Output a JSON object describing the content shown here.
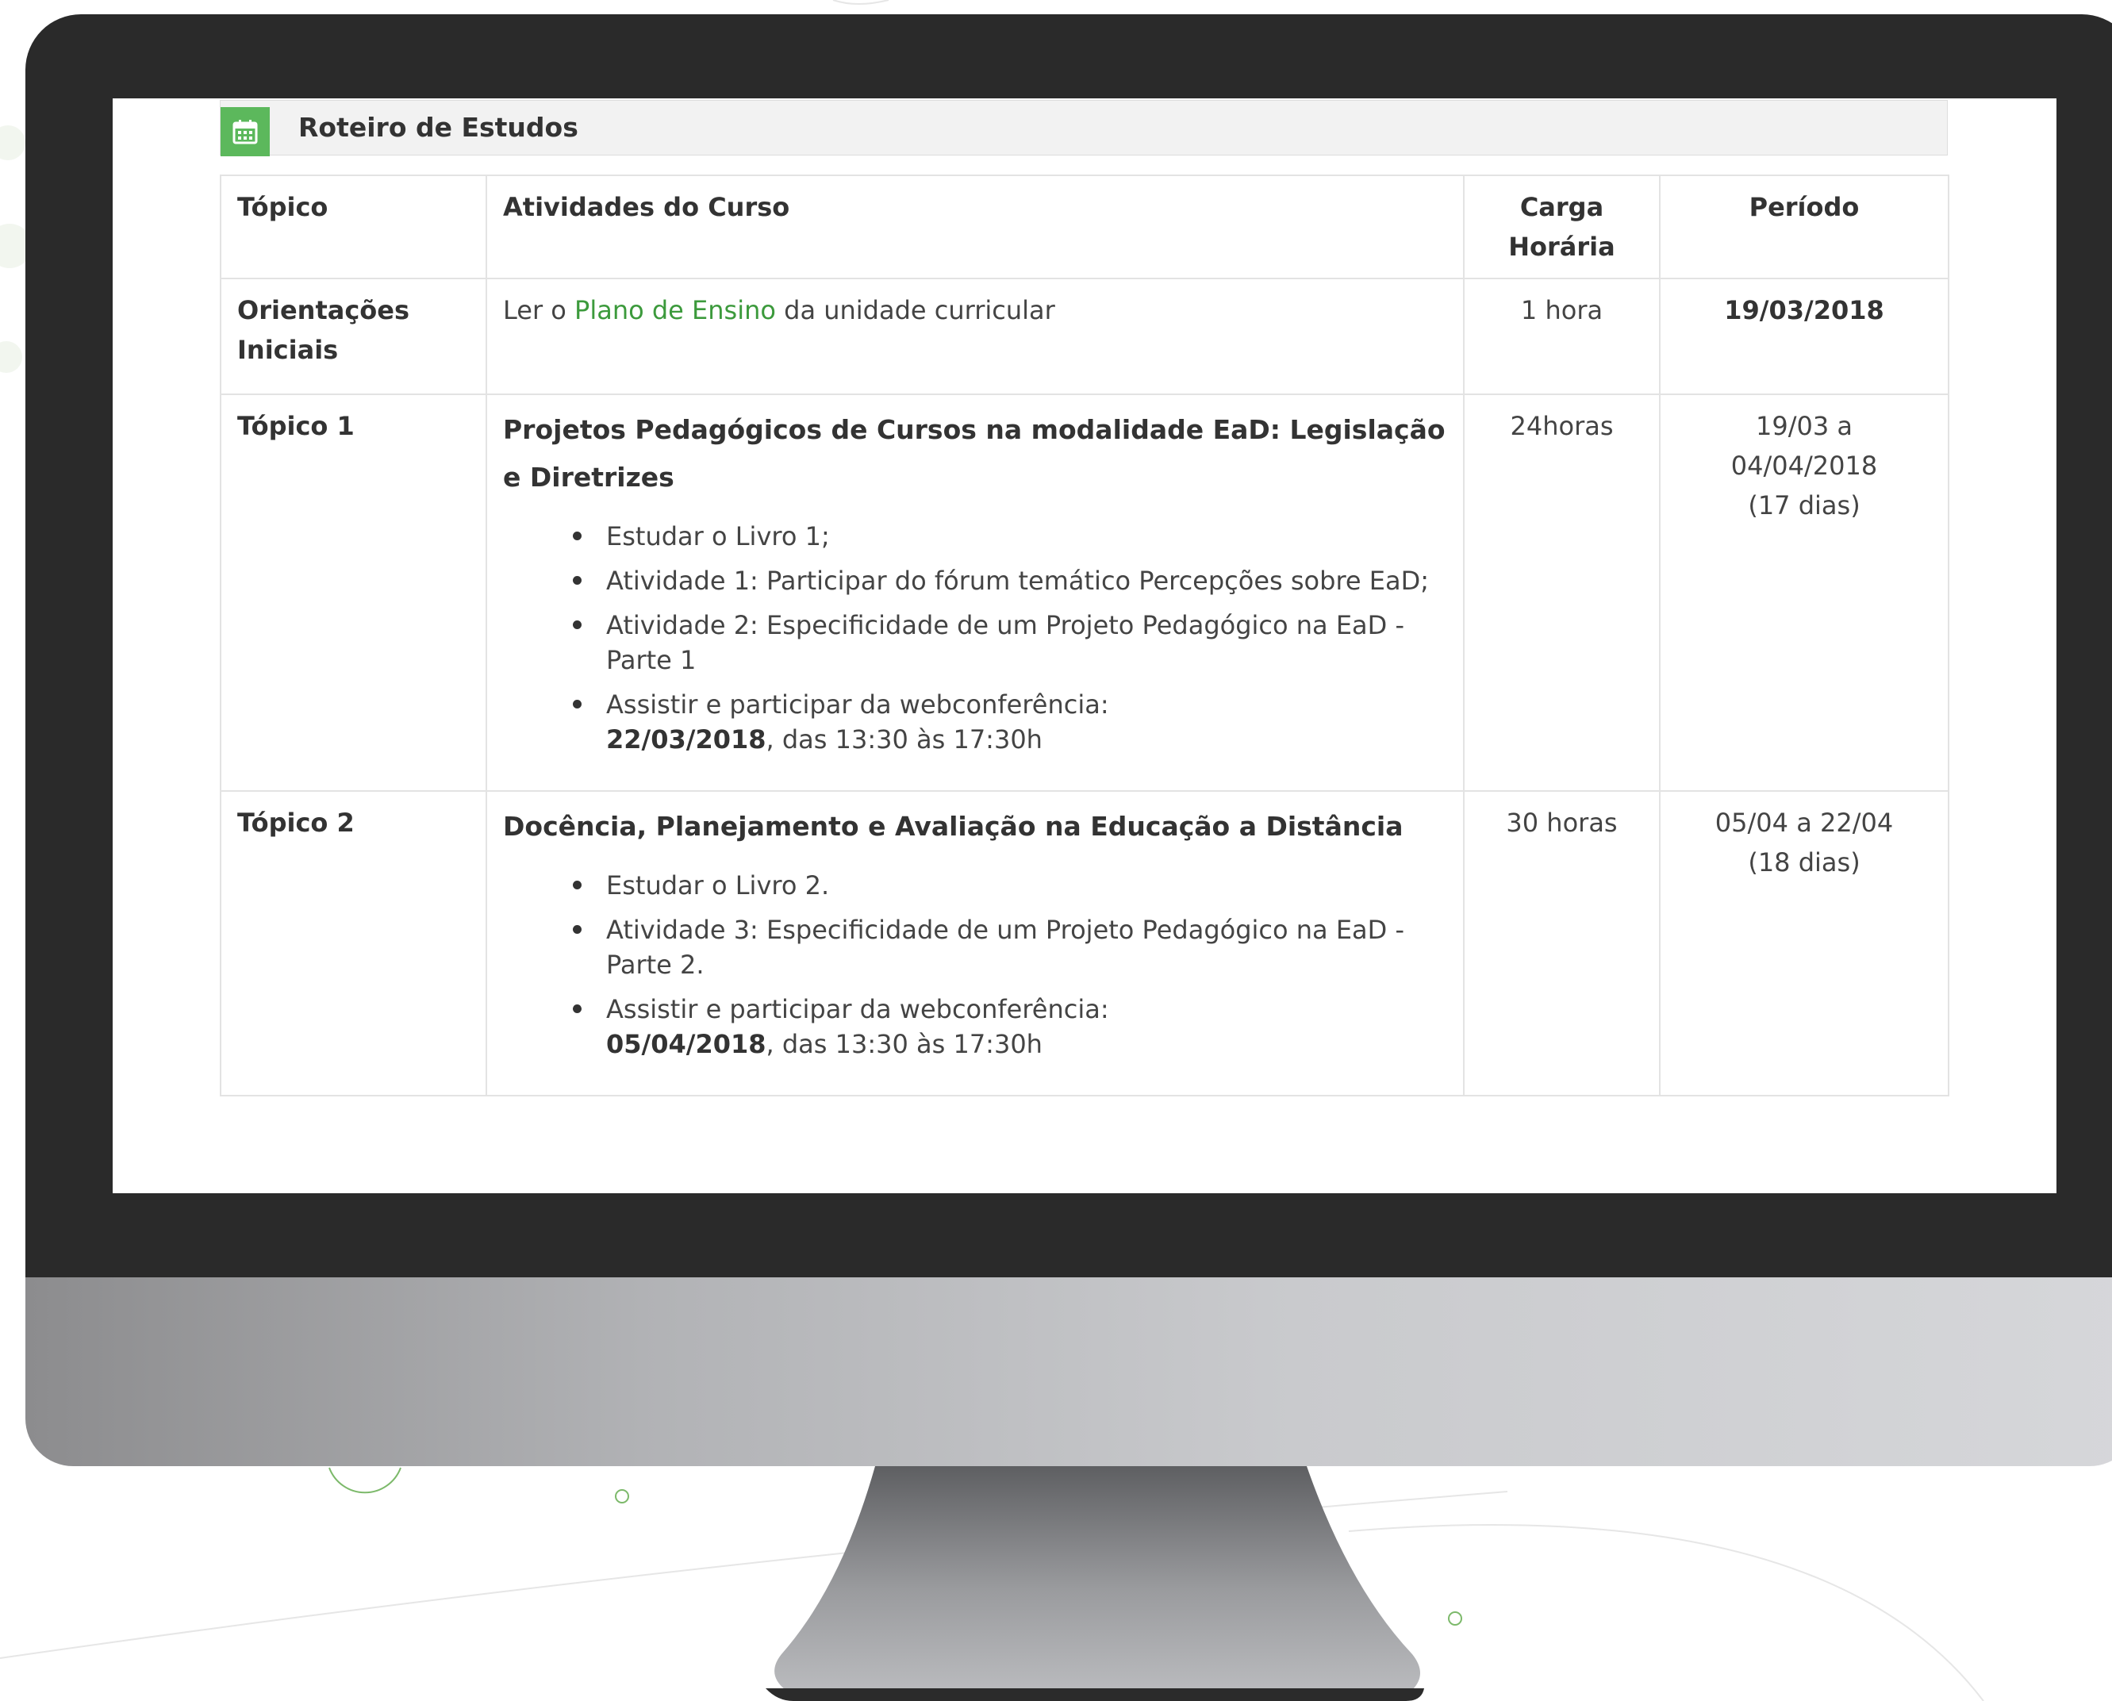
{
  "panel": {
    "icon": "calendar-icon",
    "title": "Roteiro de Estudos"
  },
  "table": {
    "headers": {
      "topic": "Tópico",
      "activities": "Atividades do Curso",
      "workload_line1": "Carga",
      "workload_line2": "Horária",
      "period": "Período"
    },
    "rows": [
      {
        "topic_line1": "Orientações",
        "topic_line2": "Iniciais",
        "activity_prefix": "Ler o ",
        "activity_link": "Plano de Ensino",
        "activity_suffix": " da unidade curricular",
        "workload": "1 hora",
        "period": "19/03/2018"
      },
      {
        "topic": "Tópico 1",
        "title": "Projetos Pedagógicos de Cursos na modalidade EaD: Legislação e Diretrizes",
        "items": [
          "Estudar o Livro 1;",
          "Atividade 1: Participar do fórum temático  Percepções sobre EaD;",
          "Atividade 2: Especificidade de um Projeto Pedagógico na EaD - Parte 1",
          "Assistir e participar da webconferência:"
        ],
        "webconf_date": "22/03/2018",
        "webconf_time": ", das 13:30 às 17:30h",
        "workload": "24horas",
        "period_line1": "19/03 a",
        "period_line2": "04/04/2018",
        "period_line3": "(17 dias)"
      },
      {
        "topic": "Tópico 2",
        "title": "Docência, Planejamento e Avaliação na Educação a Distância",
        "items": [
          "Estudar o Livro 2.",
          "Atividade 3: Especificidade de um Projeto Pedagógico na EaD - Parte 2.",
          "Assistir e participar da webconferência:"
        ],
        "webconf_date": "05/04/2018",
        "webconf_time": ", das 13:30 às 17:30h",
        "workload": "30 horas",
        "period_line1": "05/04 a 22/04",
        "period_line2": "(18 dias)"
      }
    ]
  },
  "colors": {
    "accent_green": "#5cb85c",
    "link_green": "#3c9a3c",
    "bezel": "#2a2a2a"
  }
}
